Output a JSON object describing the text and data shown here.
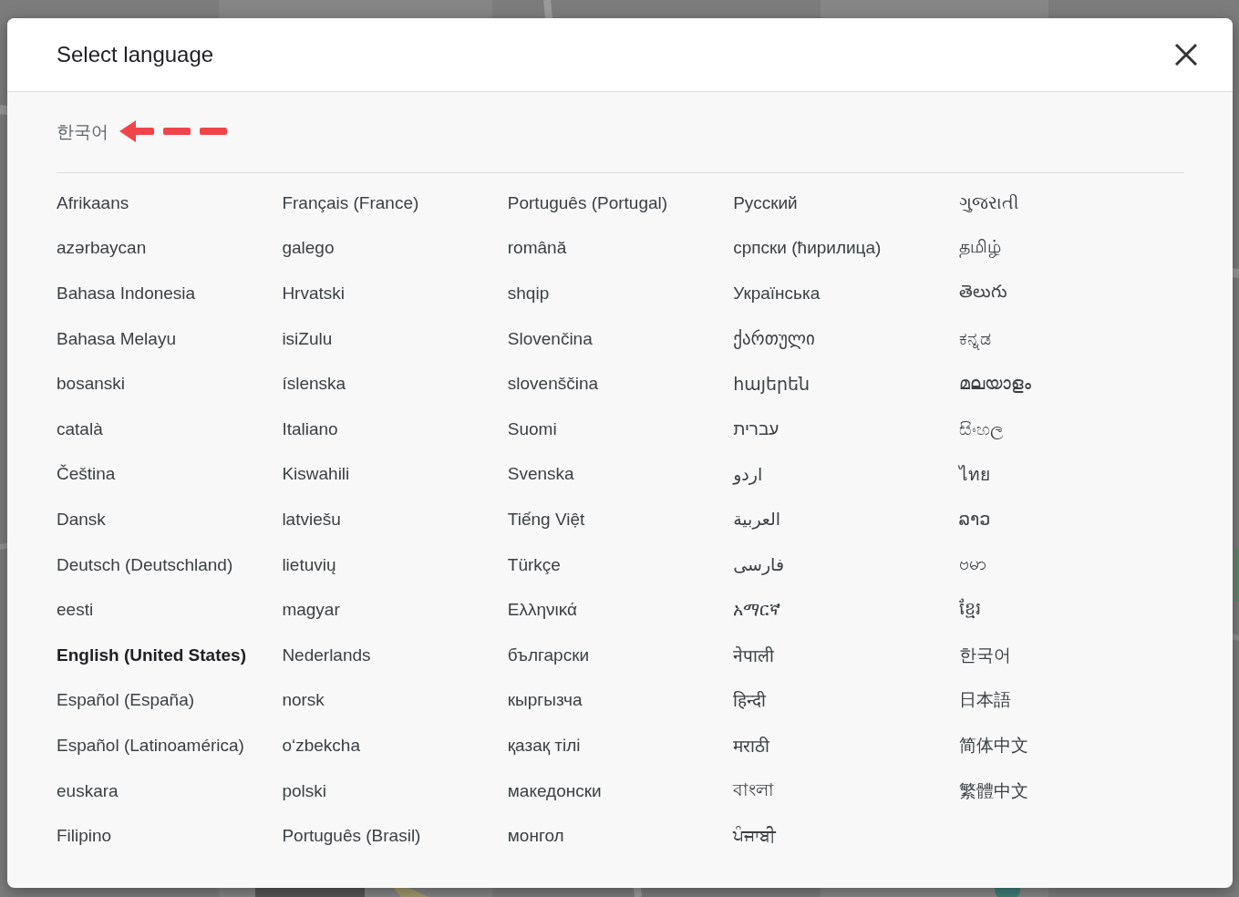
{
  "dialog": {
    "title": "Select language",
    "current_language": "한국어",
    "languages": [
      {
        "label": "Afrikaans",
        "selected": false
      },
      {
        "label": "azərbaycan",
        "selected": false
      },
      {
        "label": "Bahasa Indonesia",
        "selected": false
      },
      {
        "label": "Bahasa Melayu",
        "selected": false
      },
      {
        "label": "bosanski",
        "selected": false
      },
      {
        "label": "català",
        "selected": false
      },
      {
        "label": "Čeština",
        "selected": false
      },
      {
        "label": "Dansk",
        "selected": false
      },
      {
        "label": "Deutsch (Deutschland)",
        "selected": false
      },
      {
        "label": "eesti",
        "selected": false
      },
      {
        "label": "English (United States)",
        "selected": true
      },
      {
        "label": "Español (España)",
        "selected": false
      },
      {
        "label": "Español (Latinoamérica)",
        "selected": false
      },
      {
        "label": "euskara",
        "selected": false
      },
      {
        "label": "Filipino",
        "selected": false
      },
      {
        "label": "Français (France)",
        "selected": false
      },
      {
        "label": "galego",
        "selected": false
      },
      {
        "label": "Hrvatski",
        "selected": false
      },
      {
        "label": "isiZulu",
        "selected": false
      },
      {
        "label": "íslenska",
        "selected": false
      },
      {
        "label": "Italiano",
        "selected": false
      },
      {
        "label": "Kiswahili",
        "selected": false
      },
      {
        "label": "latviešu",
        "selected": false
      },
      {
        "label": "lietuvių",
        "selected": false
      },
      {
        "label": "magyar",
        "selected": false
      },
      {
        "label": "Nederlands",
        "selected": false
      },
      {
        "label": "norsk",
        "selected": false
      },
      {
        "label": "oʻzbekcha",
        "selected": false
      },
      {
        "label": "polski",
        "selected": false
      },
      {
        "label": "Português (Brasil)",
        "selected": false
      },
      {
        "label": "Português (Portugal)",
        "selected": false
      },
      {
        "label": "română",
        "selected": false
      },
      {
        "label": "shqip",
        "selected": false
      },
      {
        "label": "Slovenčina",
        "selected": false
      },
      {
        "label": "slovenščina",
        "selected": false
      },
      {
        "label": "Suomi",
        "selected": false
      },
      {
        "label": "Svenska",
        "selected": false
      },
      {
        "label": "Tiếng Việt",
        "selected": false
      },
      {
        "label": "Türkçe",
        "selected": false
      },
      {
        "label": "Ελληνικά",
        "selected": false
      },
      {
        "label": "български",
        "selected": false
      },
      {
        "label": "кыргызча",
        "selected": false
      },
      {
        "label": "қазақ тілі",
        "selected": false
      },
      {
        "label": "македонски",
        "selected": false
      },
      {
        "label": "монгол",
        "selected": false
      },
      {
        "label": "Русский",
        "selected": false
      },
      {
        "label": "српски (ћирилица)",
        "selected": false
      },
      {
        "label": "Українська",
        "selected": false
      },
      {
        "label": "ქართული",
        "selected": false
      },
      {
        "label": "հայերեն",
        "selected": false
      },
      {
        "label": "עברית",
        "selected": false
      },
      {
        "label": "اردو",
        "selected": false
      },
      {
        "label": "العربية",
        "selected": false
      },
      {
        "label": "فارسی",
        "selected": false
      },
      {
        "label": "አማርኛ",
        "selected": false
      },
      {
        "label": "नेपाली",
        "selected": false
      },
      {
        "label": "हिन्दी",
        "selected": false
      },
      {
        "label": "मराठी",
        "selected": false
      },
      {
        "label": "বাংলা",
        "selected": false
      },
      {
        "label": "ਪੰਜਾਬੀ",
        "selected": false
      },
      {
        "label": "ગુજરાતી",
        "selected": false
      },
      {
        "label": "தமிழ்",
        "selected": false
      },
      {
        "label": "తెలుగు",
        "selected": false
      },
      {
        "label": "ಕನ್ನಡ",
        "selected": false
      },
      {
        "label": "മലയാളം",
        "selected": false
      },
      {
        "label": "සිංහල",
        "selected": false
      },
      {
        "label": "ไทย",
        "selected": false
      },
      {
        "label": "ລາວ",
        "selected": false
      },
      {
        "label": "ဗမာ",
        "selected": false
      },
      {
        "label": "ខ្មែរ",
        "selected": false
      },
      {
        "label": "한국어",
        "selected": false
      },
      {
        "label": "日本語",
        "selected": false
      },
      {
        "label": "简体中文",
        "selected": false
      },
      {
        "label": "繁體中文",
        "selected": false
      }
    ]
  }
}
